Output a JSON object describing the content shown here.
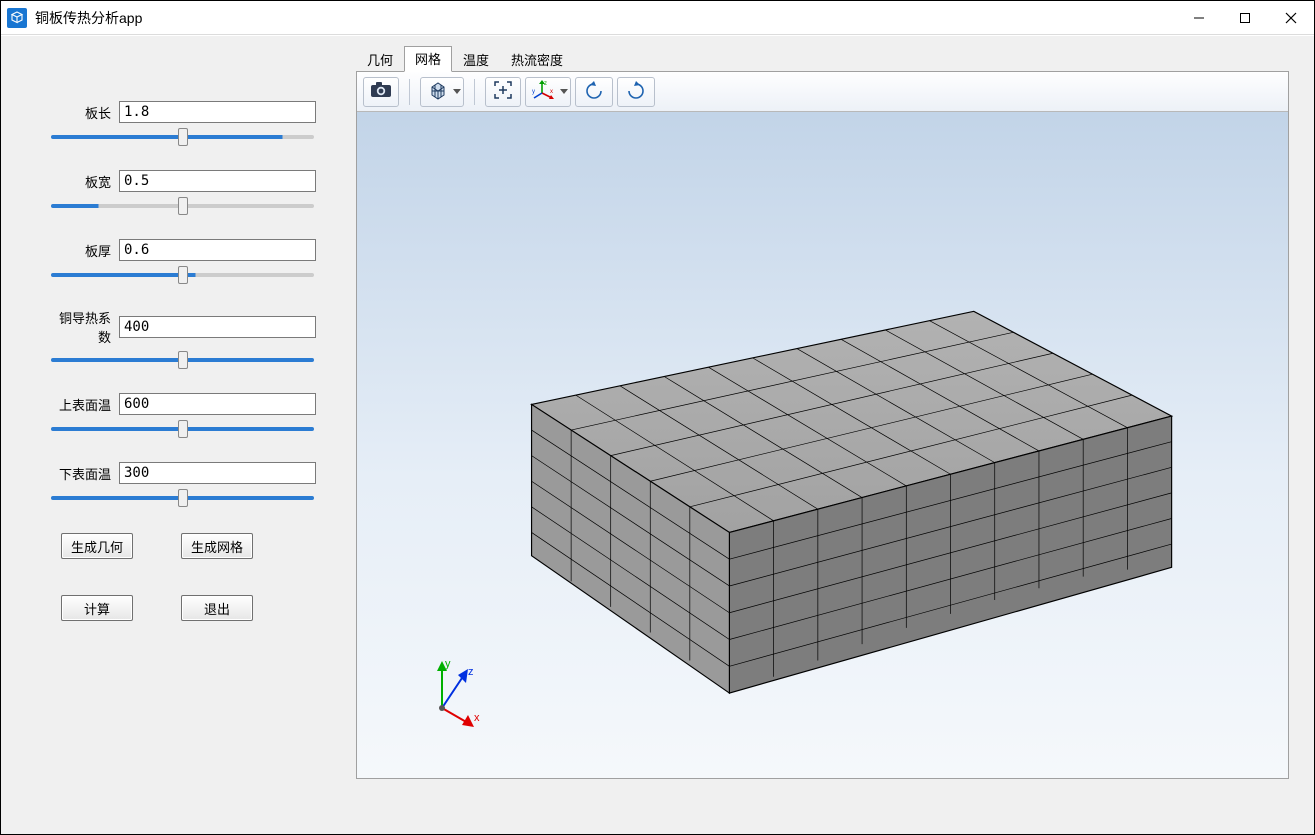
{
  "window": {
    "title": "铜板传热分析app"
  },
  "params": [
    {
      "label": "板长",
      "value": "1.8",
      "fill": 88
    },
    {
      "label": "板宽",
      "value": "0.5",
      "fill": 18
    },
    {
      "label": "板厚",
      "value": "0.6",
      "fill": 55
    },
    {
      "label": "铜导热系数",
      "value": "400",
      "fill": 100
    },
    {
      "label": "上表面温",
      "value": "600",
      "fill": 100
    },
    {
      "label": "下表面温",
      "value": "300",
      "fill": 100
    }
  ],
  "buttons": {
    "gen_geom": "生成几何",
    "gen_mesh": "生成网格",
    "compute": "计算",
    "exit": "退出"
  },
  "tabs": [
    {
      "label": "几何",
      "active": false
    },
    {
      "label": "网格",
      "active": true
    },
    {
      "label": "温度",
      "active": false
    },
    {
      "label": "热流密度",
      "active": false
    }
  ],
  "axis_labels": {
    "x": "x",
    "y": "y",
    "z": "z"
  }
}
